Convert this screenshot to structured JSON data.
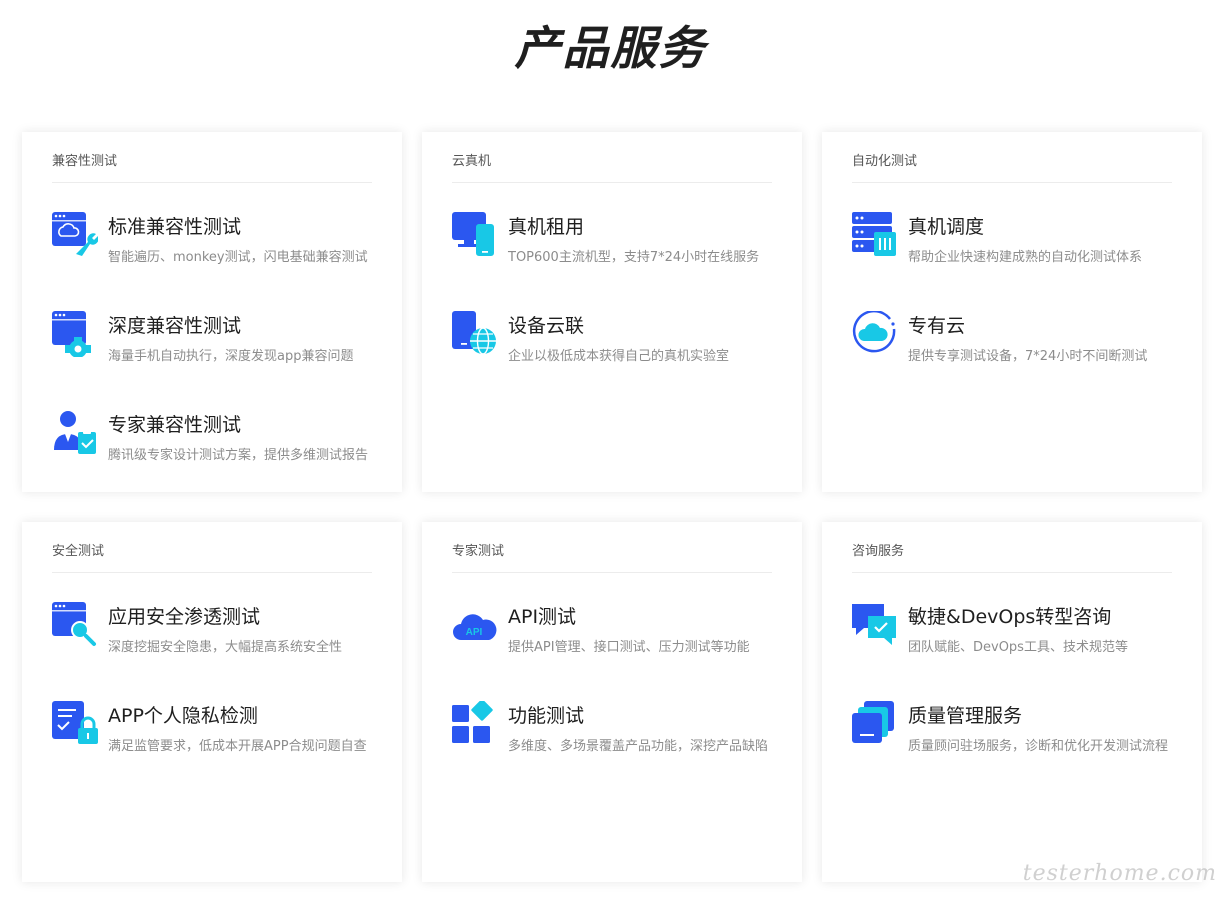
{
  "page": {
    "title": "产品服务"
  },
  "cards": [
    {
      "category": "兼容性测试",
      "items": [
        {
          "title": "标准兼容性测试",
          "desc": "智能遍历、monkey测试，闪电基础兼容测试",
          "icon": "browser-wrench-icon"
        },
        {
          "title": "深度兼容性测试",
          "desc": "海量手机自动执行，深度发现app兼容问题",
          "icon": "browser-gear-icon"
        },
        {
          "title": "专家兼容性测试",
          "desc": "腾讯级专家设计测试方案，提供多维测试报告",
          "icon": "expert-clipboard-icon"
        }
      ]
    },
    {
      "category": "云真机",
      "items": [
        {
          "title": "真机租用",
          "desc": "TOP600主流机型，支持7*24小时在线服务",
          "icon": "devices-icon"
        },
        {
          "title": "设备云联",
          "desc": "企业以极低成本获得自己的真机实验室",
          "icon": "device-globe-icon"
        }
      ]
    },
    {
      "category": "自动化测试",
      "items": [
        {
          "title": "真机调度",
          "desc": "帮助企业快速构建成熟的自动化测试体系",
          "icon": "server-rack-icon"
        },
        {
          "title": "专有云",
          "desc": "提供专享测试设备，7*24小时不间断测试",
          "icon": "private-cloud-icon"
        }
      ]
    },
    {
      "category": "安全测试",
      "items": [
        {
          "title": "应用安全渗透测试",
          "desc": "深度挖掘安全隐患，大幅提高系统安全性",
          "icon": "browser-magnifier-icon"
        },
        {
          "title": "APP个人隐私检测",
          "desc": "满足监管要求，低成本开展APP合规问题自查",
          "icon": "document-lock-icon"
        }
      ]
    },
    {
      "category": "专家测试",
      "items": [
        {
          "title": "API测试",
          "desc": "提供API管理、接口测试、压力测试等功能",
          "icon": "api-cloud-icon"
        },
        {
          "title": "功能测试",
          "desc": "多维度、多场景覆盖产品功能，深挖产品缺陷",
          "icon": "function-blocks-icon"
        }
      ]
    },
    {
      "category": "咨询服务",
      "items": [
        {
          "title": "敏捷&DevOps转型咨询",
          "desc": "团队赋能、DevOps工具、技术规范等",
          "icon": "chat-check-icon"
        },
        {
          "title": "质量管理服务",
          "desc": "质量顾问驻场服务，诊断和优化开发测试流程",
          "icon": "layered-cards-icon"
        }
      ]
    }
  ],
  "watermark": "testerhome.com",
  "colors": {
    "primary": "#2b57f0",
    "accent": "#18c8e6"
  }
}
